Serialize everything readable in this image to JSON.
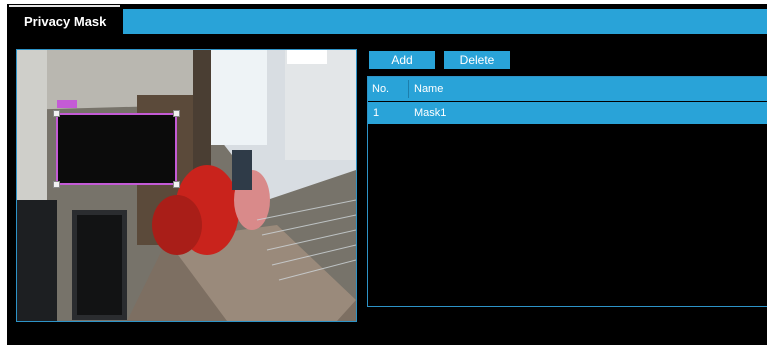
{
  "tabs": [
    {
      "label": "Privacy Mask",
      "active": true
    }
  ],
  "toolbar": {
    "add_label": "Add",
    "delete_label": "Delete"
  },
  "mask_table": {
    "columns": [
      "No.",
      "Name"
    ],
    "rows": [
      {
        "no": "1",
        "name": "Mask1",
        "selected": true
      }
    ]
  },
  "colors": {
    "accent": "#29a3d8",
    "background": "#000000",
    "mask_outline": "#c45bd6"
  }
}
